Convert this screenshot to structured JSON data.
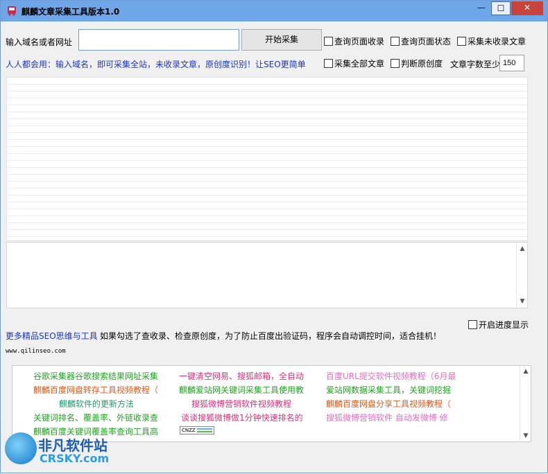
{
  "window": {
    "title": "麒麟文章采集工具版本1.0",
    "controls": {
      "minimize": "—",
      "maximize": "☐",
      "close": "✕"
    }
  },
  "top_bar": {
    "url_label": "输入域名或者网址",
    "url_value": "",
    "start_button": "开始采集",
    "checkboxes_row1": [
      "查询页面收录",
      "查询页面状态",
      "采集未收录文章"
    ],
    "slogan": "人人都会用：输入域名，即可采集全站，未收录文章，原创度识别！让SEO更简单",
    "checkboxes_row2": [
      "采集全部文章",
      "判断原创度"
    ],
    "wordcount_label": "文章字数至少",
    "wordcount_value": "150"
  },
  "progress_checkbox": "开启进度显示",
  "info": {
    "more_link": "更多精品SEO思维与工具",
    "note": "如果勾选了查收录、检查原创度，为了防止百度出验证码，程序会自动调控时间，适合挂机！",
    "site_url": "www.qilinseo.com"
  },
  "links": [
    {
      "text": "谷歌采集器谷歌搜索结果网址采集",
      "color": "#21a321"
    },
    {
      "text": "一键清空网易、搜狐邮箱，全自动",
      "color": "#e0307a"
    },
    {
      "text": "百度URL提交软件视频教程（6月最",
      "color": "#e36fbf"
    },
    {
      "text": "麒麟百度网盘转存工具视频教程（",
      "color": "#e05a1a"
    },
    {
      "text": "麒麟爱站网关键词采集工具使用教",
      "color": "#21a321"
    },
    {
      "text": "爱站网数据采集工具，关键词挖掘",
      "color": "#21a321"
    },
    {
      "text": "麒麟软件的更新方法",
      "color": "#1e9e6a"
    },
    {
      "text": "搜狐微博营销软件视频教程",
      "color": "#e0307a"
    },
    {
      "text": "麒麟百度网盘分享工具视频教程（",
      "color": "#e05a1a"
    },
    {
      "text": "关键词排名、覆盖率、外链收录查",
      "color": "#21a321"
    },
    {
      "text": "谈谈搜狐微博做1分钟快速排名的",
      "color": "#e0307a"
    },
    {
      "text": "搜狐微博营销软件 自动发微博 修",
      "color": "#e36fbf"
    },
    {
      "text": "麒麟百度关键词覆盖率查询工具高",
      "color": "#21a321"
    }
  ],
  "badge": "CNZZ",
  "watermark": {
    "line1": "非凡软件站",
    "line2": "CRSKY.com"
  }
}
